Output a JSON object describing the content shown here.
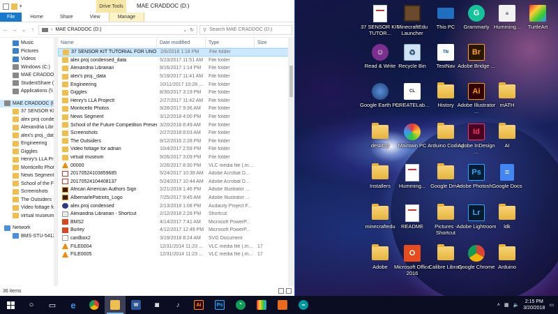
{
  "explorer": {
    "window_title": "MAE CRADDOC (D:)",
    "contextual_tab": "Drive Tools",
    "ribbon_tabs": [
      "File",
      "Home",
      "Share",
      "View",
      "Manage"
    ],
    "address": "MAE CRADDOC (D:)",
    "search_placeholder": "Search MAE CRADDOC (D:)",
    "nav_items": [
      {
        "label": "Music",
        "icon": "music-icon",
        "level": 2
      },
      {
        "label": "Pictures",
        "icon": "pictures-icon",
        "level": 2
      },
      {
        "label": "Videos",
        "icon": "videos-icon",
        "level": 2
      },
      {
        "label": "Windows (C:)",
        "icon": "drive-icon",
        "level": 2
      },
      {
        "label": "MAE CRADDOC",
        "icon": "drive-icon",
        "level": 2
      },
      {
        "label": "StudentShare (\\\\",
        "icon": "network-drive-icon",
        "level": 2
      },
      {
        "label": "Applications (\\\\",
        "icon": "network-drive-icon",
        "level": 2
      },
      {
        "label": "",
        "icon": "",
        "level": 0
      },
      {
        "label": "MAE CRADDOC (I",
        "icon": "drive-icon",
        "level": 1,
        "selected": true
      },
      {
        "label": "37 SENSOR KIT T",
        "icon": "folder-icon",
        "level": 2
      },
      {
        "label": "alex proj conden",
        "icon": "folder-icon",
        "level": 2
      },
      {
        "label": "Alexandria Librar",
        "icon": "folder-icon",
        "level": 2
      },
      {
        "label": "alex's proj._data",
        "icon": "folder-icon",
        "level": 2
      },
      {
        "label": "Engineering",
        "icon": "folder-icon",
        "level": 2
      },
      {
        "label": "Giggles",
        "icon": "folder-icon",
        "level": 2
      },
      {
        "label": "Henry's LLA Proj",
        "icon": "folder-icon",
        "level": 2
      },
      {
        "label": "Monticello Photo",
        "icon": "folder-icon",
        "level": 2
      },
      {
        "label": "News Segment",
        "icon": "folder-icon",
        "level": 2
      },
      {
        "label": "School of the Fu",
        "icon": "folder-icon",
        "level": 2
      },
      {
        "label": "Screenshots",
        "icon": "folder-icon",
        "level": 2
      },
      {
        "label": "The Outsiders",
        "icon": "folder-icon",
        "level": 2
      },
      {
        "label": "Video fottage fo",
        "icon": "folder-icon",
        "level": 2
      },
      {
        "label": "virtual museum",
        "icon": "folder-icon",
        "level": 2
      },
      {
        "label": "",
        "icon": "",
        "level": 0
      },
      {
        "label": "Network",
        "icon": "network-icon",
        "level": 1
      },
      {
        "label": "BMS-STU-54122",
        "icon": "computer-icon",
        "level": 2
      }
    ],
    "columns": {
      "name": "Name",
      "date": "Date modified",
      "type": "Type",
      "size": "Size"
    },
    "files": [
      {
        "name": "37 SENSOR KIT TUTORIAL FOR UNO",
        "date": "2/6/2018 1:18 PM",
        "type": "File folder",
        "size": "",
        "icon": "folder",
        "selected": true
      },
      {
        "name": "alex proj condensed_data",
        "date": "5/23/2017 11:51 AM",
        "type": "File folder",
        "size": "",
        "icon": "folder"
      },
      {
        "name": "Alexandria Librarian",
        "date": "8/16/2017 1:14 PM",
        "type": "File folder",
        "size": "",
        "icon": "folder"
      },
      {
        "name": "alex's proj._data",
        "date": "5/19/2017 11:41 AM",
        "type": "File folder",
        "size": "",
        "icon": "folder"
      },
      {
        "name": "Engineering",
        "date": "10/11/2017 10:28 ...",
        "type": "File folder",
        "size": "",
        "icon": "folder"
      },
      {
        "name": "Giggles",
        "date": "8/30/2017 3:19 PM",
        "type": "File folder",
        "size": "",
        "icon": "folder"
      },
      {
        "name": "Henry's LLA Projectt",
        "date": "2/27/2017 11:42 AM",
        "type": "File folder",
        "size": "",
        "icon": "folder"
      },
      {
        "name": "Monticello Photos",
        "date": "9/28/2017 9:36 AM",
        "type": "File folder",
        "size": "",
        "icon": "folder"
      },
      {
        "name": "News Segment",
        "date": "3/12/2018 4:00 PM",
        "type": "File folder",
        "size": "",
        "icon": "folder"
      },
      {
        "name": "School of the Future Competition Presen...",
        "date": "3/20/2018 8:49 AM",
        "type": "File folder",
        "size": "",
        "icon": "folder"
      },
      {
        "name": "Screenshots",
        "date": "2/27/2018 8:03 AM",
        "type": "File folder",
        "size": "",
        "icon": "folder"
      },
      {
        "name": "The Outsiders",
        "date": "9/12/2016 2:28 PM",
        "type": "File folder",
        "size": "",
        "icon": "folder"
      },
      {
        "name": "Video fottage for adrian",
        "date": "10/4/2017 2:59 PM",
        "type": "File folder",
        "size": "",
        "icon": "folder"
      },
      {
        "name": "virtual museum",
        "date": "9/26/2017 3:09 PM",
        "type": "File folder",
        "size": "",
        "icon": "folder"
      },
      {
        "name": "00000",
        "date": "2/26/2017 8:30 PM",
        "type": "VLC media file (.m...",
        "size": "",
        "icon": "vlc"
      },
      {
        "name": "20170524103859685",
        "date": "5/24/2017 10:39 AM",
        "type": "Adobe Acrobat D...",
        "size": "",
        "icon": "pdf"
      },
      {
        "name": "20170524104408137",
        "date": "5/24/2017 10:44 AM",
        "type": "Adobe Acrobat D...",
        "size": "",
        "icon": "pdf"
      },
      {
        "name": "African American Authors Sign",
        "date": "2/21/2018 1:46 PM",
        "type": "Adobe Illustrator ...",
        "size": "",
        "icon": "ai"
      },
      {
        "name": "AlbemarlePatriots_Logo",
        "date": "7/25/2017 9:45 AM",
        "type": "Adobe Illustrator ...",
        "size": "",
        "icon": "ai"
      },
      {
        "name": "alex proj condensed",
        "date": "2/13/2018 1:08 PM",
        "type": "Audacity Project F...",
        "size": "",
        "icon": "audacity"
      },
      {
        "name": "Alexandria Librarian - Shortcut",
        "date": "2/12/2018 2:28 PM",
        "type": "Shortcut",
        "size": "",
        "icon": "shortcut"
      },
      {
        "name": "BMS2",
        "date": "4/14/2017 7:41 AM",
        "type": "Microsoft PowerP...",
        "size": "",
        "icon": "ppt"
      },
      {
        "name": "Burley",
        "date": "4/12/2017 12:49 PM",
        "type": "Microsoft PowerP...",
        "size": "",
        "icon": "ppt"
      },
      {
        "name": "cardbox2",
        "date": "3/19/2018 8:24 AM",
        "type": "SVG Document",
        "size": "",
        "icon": "svg"
      },
      {
        "name": "FILE0004",
        "date": "12/31/2014 11:23 ...",
        "type": "VLC media file (.m...",
        "size": "17",
        "icon": "vlc"
      },
      {
        "name": "FILE0005",
        "date": "12/31/2014 11:23 ...",
        "type": "VLC media file (.m...",
        "size": "17",
        "icon": "vlc"
      }
    ],
    "status": "36 items"
  },
  "desktop_icons": [
    {
      "label": "37 SENSOR KIT TUTOR...",
      "icon": "pdf-icon"
    },
    {
      "label": "MinecraftEdu Launcher",
      "icon": "minecraft-icon"
    },
    {
      "label": "This PC",
      "icon": "this-pc-icon"
    },
    {
      "label": "Grammarly",
      "icon": "grammarly-icon"
    },
    {
      "label": "Humming...",
      "icon": "humming-icon"
    },
    {
      "label": "TurtleArt",
      "icon": "turtleart-icon"
    },
    {
      "label": "Read & Write",
      "icon": "read-write-icon"
    },
    {
      "label": "Recycle Bin",
      "icon": "recycle-bin-icon"
    },
    {
      "label": "TestNav",
      "icon": "testnav-icon"
    },
    {
      "label": "Adobe Bridge ...",
      "icon": "adobe-bridge-icon"
    },
    {
      "label": "Google Earth Pro",
      "icon": "google-earth-icon"
    },
    {
      "label": "CREATELab...",
      "icon": "createlab-icon"
    },
    {
      "label": "History",
      "icon": "folder-icon"
    },
    {
      "label": "Adobe Illustrator ...",
      "icon": "adobe-illustrator-icon"
    },
    {
      "label": "mATH",
      "icon": "folder-icon"
    },
    {
      "label": "desktop",
      "icon": "folder-icon"
    },
    {
      "label": "Maintain PC",
      "icon": "maintain-pc-icon"
    },
    {
      "label": "Arduino Coding",
      "icon": "folder-icon"
    },
    {
      "label": "Adobe InDesign ...",
      "icon": "adobe-indesign-icon"
    },
    {
      "label": "AI",
      "icon": "folder-icon"
    },
    {
      "label": "Installers",
      "icon": "folder-icon"
    },
    {
      "label": "Humming...",
      "icon": "pdf-icon"
    },
    {
      "label": "Google Drive",
      "icon": "google-drive-folder-icon"
    },
    {
      "label": "Adobe Photosh...",
      "icon": "adobe-photoshop-icon"
    },
    {
      "label": "Google Docs",
      "icon": "google-docs-icon"
    },
    {
      "label": "minecraftedu",
      "icon": "folder-icon"
    },
    {
      "label": "README",
      "icon": "pdf-icon"
    },
    {
      "label": "Pictures - Shortcut",
      "icon": "pictures-shortcut-icon"
    },
    {
      "label": "Adobe Lightroom",
      "icon": "adobe-lightroom-icon"
    },
    {
      "label": "ldk",
      "icon": "folder-icon"
    },
    {
      "label": "Adobe",
      "icon": "folder-icon"
    },
    {
      "label": "Microsoft Office 2016",
      "icon": "office-icon"
    },
    {
      "label": "Calibre Library",
      "icon": "folder-icon"
    },
    {
      "label": "Google Chrome",
      "icon": "chrome-icon"
    },
    {
      "label": "Arduino",
      "icon": "folder-icon"
    }
  ],
  "taskbar": {
    "time": "2:15 PM",
    "date": "3/20/2018"
  }
}
